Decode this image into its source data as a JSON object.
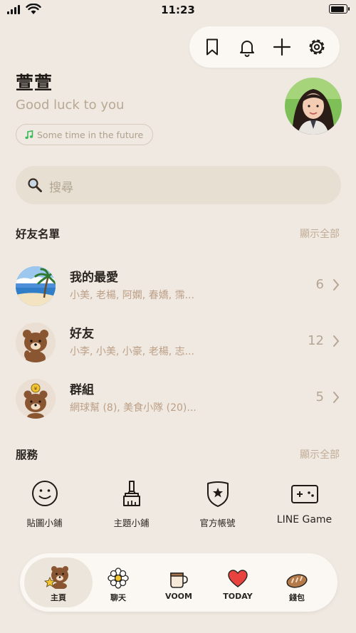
{
  "status_bar": {
    "time": "11:23"
  },
  "profile": {
    "name": "萱萱",
    "status_message": "Good luck to you",
    "music": "Some time in the future"
  },
  "search": {
    "placeholder": "搜尋"
  },
  "friends_section": {
    "title": "好友名單",
    "show_all": "顯示全部",
    "rows": [
      {
        "title": "我的最愛",
        "subtitle": "小美, 老楊, 阿嫻, 春嬌, 霈...",
        "count": "6"
      },
      {
        "title": "好友",
        "subtitle": "小李, 小美, 小豪, 老楊, 志...",
        "count": "12"
      },
      {
        "title": "群組",
        "subtitle": "網球幫 (8), 美食小隊 (20)...",
        "count": "5"
      }
    ]
  },
  "services_section": {
    "title": "服務",
    "show_all": "顯示全部",
    "items": [
      {
        "label": "貼圖小鋪",
        "icon": "smiley-icon"
      },
      {
        "label": "主題小鋪",
        "icon": "brush-icon"
      },
      {
        "label": "官方帳號",
        "icon": "shield-star-icon"
      },
      {
        "label": "LINE Game",
        "icon": "gamepad-icon"
      }
    ]
  },
  "bottom_nav": {
    "items": [
      {
        "label": "主頁",
        "icon": "brown-bear-icon",
        "active": true
      },
      {
        "label": "聊天",
        "icon": "flower-icon"
      },
      {
        "label": "VOOM",
        "icon": "mug-icon"
      },
      {
        "label": "TODAY",
        "icon": "heart-icon"
      },
      {
        "label": "錢包",
        "icon": "bread-icon"
      }
    ]
  },
  "colors": {
    "background": "#efe9e1",
    "card": "#fbf8f3",
    "search_bg": "#e6dfd2",
    "muted_text": "#bd9f86",
    "music_note": "#3cb95a"
  }
}
